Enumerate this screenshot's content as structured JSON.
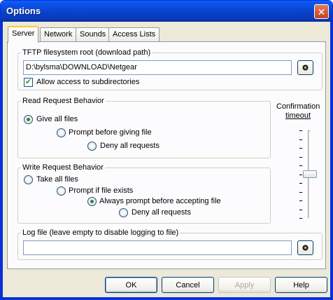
{
  "window": {
    "title": "Options",
    "close_glyph": "✕"
  },
  "tabs": [
    {
      "label": "Server",
      "active": true
    },
    {
      "label": "Network",
      "active": false
    },
    {
      "label": "Sounds",
      "active": false
    },
    {
      "label": "Access Lists",
      "active": false
    }
  ],
  "tftp_root": {
    "legend": "TFTP filesystem root (download path)",
    "path_value": "D:\\bylsma\\DOWNLOAD\\Netgear",
    "allow_subdirs_label": "Allow access to subdirectories",
    "allow_subdirs_checked": true
  },
  "read_request": {
    "legend": "Read Request Behavior",
    "options": [
      {
        "label": "Give all files",
        "selected": true
      },
      {
        "label": "Prompt before giving file",
        "selected": false
      },
      {
        "label": "Deny all requests",
        "selected": false
      }
    ]
  },
  "write_request": {
    "legend": "Write Request Behavior",
    "options": [
      {
        "label": "Take all files",
        "selected": false
      },
      {
        "label": "Prompt if file exists",
        "selected": false
      },
      {
        "label": "Always prompt before accepting file",
        "selected": true
      },
      {
        "label": "Deny all requests",
        "selected": false
      }
    ]
  },
  "confirmation": {
    "label_line1": "Confirmation",
    "label_line2": "timeout",
    "level_fraction": 0.5
  },
  "log_file": {
    "legend": "Log file (leave empty to disable logging to file)",
    "value": ""
  },
  "buttons": {
    "ok": "OK",
    "cancel": "Cancel",
    "apply": "Apply",
    "help": "Help"
  },
  "colors": {
    "titlebar": "#0840c8",
    "dialog_bg": "#ece9d8",
    "tab_highlight": "#ffc83c",
    "disabled_text": "#aca899"
  },
  "icons": {
    "browse": "browse-icon",
    "check": "checkmark-icon"
  }
}
